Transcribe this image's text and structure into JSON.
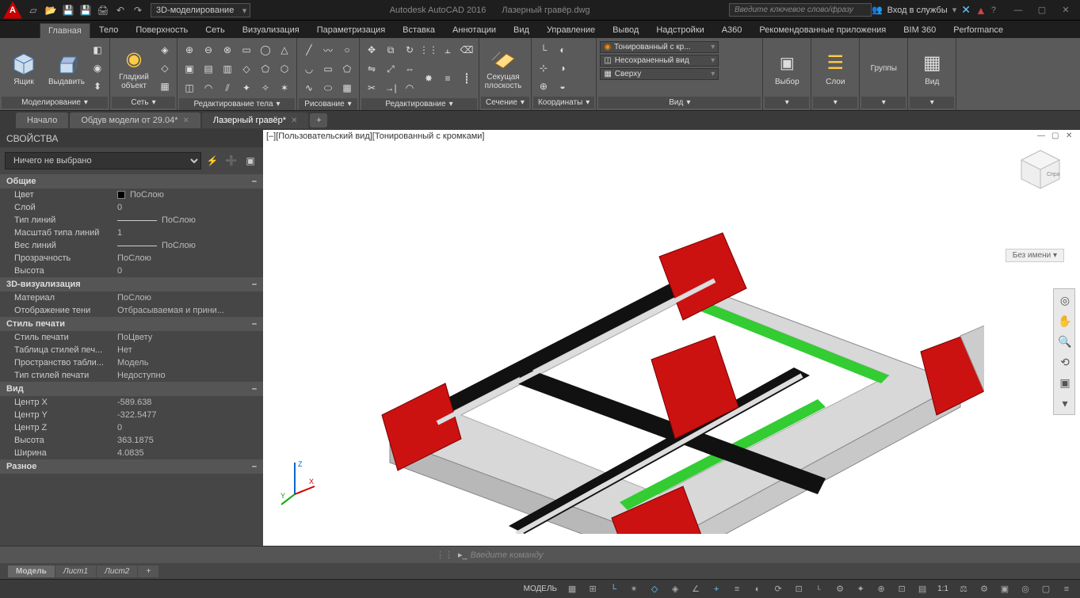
{
  "title": {
    "app": "Autodesk AutoCAD 2016",
    "file": "Лазерный гравёр.dwg",
    "workspace": "3D-моделирование",
    "search_placeholder": "Введите ключевое слово/фразу",
    "signin": "Вход в службы"
  },
  "ribbonTabs": [
    "Главная",
    "Тело",
    "Поверхность",
    "Сеть",
    "Визуализация",
    "Параметризация",
    "Вставка",
    "Аннотации",
    "Вид",
    "Управление",
    "Вывод",
    "Надстройки",
    "A360",
    "Рекомендованные приложения",
    "BIM 360",
    "Performance"
  ],
  "ribbon": {
    "modeling": {
      "title": "Моделирование",
      "box": "Ящик",
      "extrude": "Выдавить",
      "smooth": "Гладкий объект"
    },
    "mesh": {
      "title": "Сеть"
    },
    "solidedit": {
      "title": "Редактирование тела"
    },
    "draw": {
      "title": "Рисование"
    },
    "modify": {
      "title": "Редактирование"
    },
    "section": {
      "title": "Сечение",
      "sectionplane": "Секущая плоскость"
    },
    "coords": {
      "title": "Координаты",
      "visual": "Тонированный с кр...",
      "view": "Несохраненный вид",
      "top": "Сверху"
    },
    "view": {
      "title": "Вид"
    },
    "selection": {
      "title": "Выбор",
      "label": "Выбор"
    },
    "layers": {
      "title": "Слои",
      "label": "Слои"
    },
    "groups": {
      "title": "",
      "label": "Группы"
    },
    "viewpanel": {
      "title": "",
      "label": "Вид"
    }
  },
  "fileTabs": [
    {
      "label": "Начало",
      "active": false,
      "closable": false
    },
    {
      "label": "Обдув модели от 29.04*",
      "active": false,
      "closable": true
    },
    {
      "label": "Лазерный гравёр*",
      "active": true,
      "closable": true
    }
  ],
  "props": {
    "title": "СВОЙСТВА",
    "selector": "Ничего не выбрано",
    "groups": [
      {
        "name": "Общие",
        "rows": [
          {
            "label": "Цвет",
            "value": "ПоСлою",
            "swatch": true
          },
          {
            "label": "Слой",
            "value": "0"
          },
          {
            "label": "Тип линий",
            "value": "ПоСлою",
            "line": true
          },
          {
            "label": "Масштаб типа линий",
            "value": "1"
          },
          {
            "label": "Вес линий",
            "value": "ПоСлою",
            "line": true
          },
          {
            "label": "Прозрачность",
            "value": "ПоСлою"
          },
          {
            "label": "Высота",
            "value": "0"
          }
        ]
      },
      {
        "name": "3D-визуализация",
        "rows": [
          {
            "label": "Материал",
            "value": "ПоСлою"
          },
          {
            "label": "Отображение тени",
            "value": "Отбрасываемая и прини..."
          }
        ]
      },
      {
        "name": "Стиль печати",
        "rows": [
          {
            "label": "Стиль печати",
            "value": "ПоЦвету"
          },
          {
            "label": "Таблица стилей печ...",
            "value": "Нет"
          },
          {
            "label": "Пространство табли...",
            "value": "Модель"
          },
          {
            "label": "Тип стилей печати",
            "value": "Недоступно"
          }
        ]
      },
      {
        "name": "Вид",
        "rows": [
          {
            "label": "Центр X",
            "value": "-589.638"
          },
          {
            "label": "Центр Y",
            "value": "-322.5477"
          },
          {
            "label": "Центр Z",
            "value": "0"
          },
          {
            "label": "Высота",
            "value": "363.1875"
          },
          {
            "label": "Ширина",
            "value": "4.0835"
          }
        ]
      },
      {
        "name": "Разное",
        "rows": []
      }
    ]
  },
  "viewport": {
    "label": "[–][Пользовательский вид][Тонированный с кромками]",
    "namedView": "Без имени",
    "ucs": {
      "x": "X",
      "y": "Y",
      "z": "Z"
    }
  },
  "cmd": {
    "placeholder": "Введите команду"
  },
  "layoutTabs": [
    "Модель",
    "Лист1",
    "Лист2"
  ],
  "status": {
    "model": "МОДЕЛЬ",
    "scale": "1:1"
  }
}
